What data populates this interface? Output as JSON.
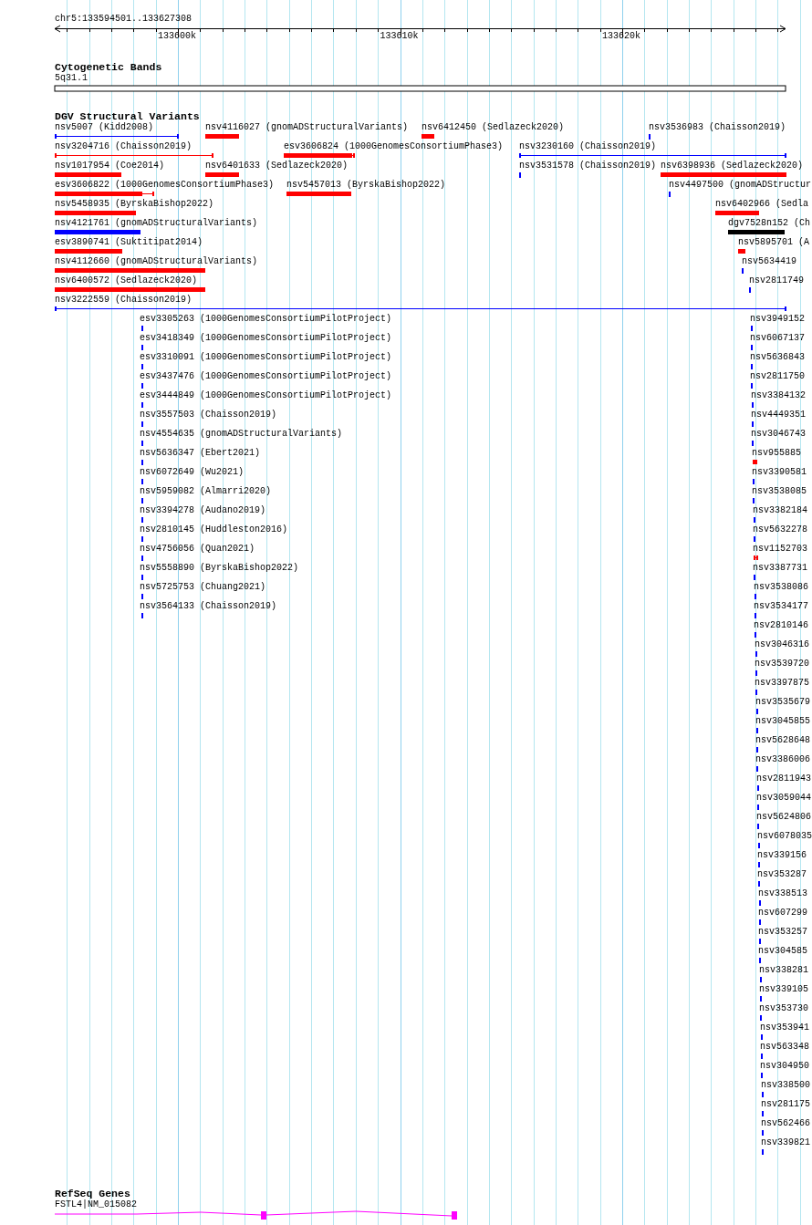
{
  "ruler": {
    "region": "chr5:133594501..133627308",
    "ticks": [
      "133600k",
      "133610k",
      "133620k"
    ]
  },
  "cytobands": {
    "title": "Cytogenetic Bands",
    "band": "5q31.1"
  },
  "variants": {
    "title": "DGV Structural Variants",
    "features": [
      {
        "label": "nsv5007 (Kidd2008)",
        "kind": "line",
        "color": "#0000ff"
      },
      {
        "label": "nsv4116027 (gnomADStructuralVariants)",
        "kind": "bar",
        "color": "#ff0000"
      },
      {
        "label": "nsv6412450 (Sedlazeck2020)",
        "kind": "bar",
        "color": "#ff0000"
      },
      {
        "label": "nsv3536983 (Chaisson2019)",
        "kind": "tick",
        "color": "#0000ff"
      },
      {
        "label": "nsv3204716 (Chaisson2019)",
        "kind": "line",
        "color": "#ff0000"
      },
      {
        "label": "esv3606824 (1000GenomesConsortiumPhase3)",
        "kind": "tail",
        "color": "#ff0000"
      },
      {
        "label": "nsv3230160 (Chaisson2019)",
        "kind": "line",
        "color": "#0000ff"
      },
      {
        "label": "nsv1017954 (Coe2014)",
        "kind": "bar",
        "color": "#ff0000"
      },
      {
        "label": "nsv6401633 (Sedlazeck2020)",
        "kind": "bar",
        "color": "#ff0000"
      },
      {
        "label": "nsv3531578 (Chaisson2019)",
        "kind": "tick",
        "color": "#0000ff"
      },
      {
        "label": "nsv6398936 (Sedlazeck2020)",
        "kind": "bar",
        "color": "#ff0000"
      },
      {
        "label": "esv3606822 (1000GenomesConsortiumPhase3)",
        "kind": "tail",
        "color": "#ff0000"
      },
      {
        "label": "nsv5457013 (ByrskaBishop2022)",
        "kind": "bar",
        "color": "#ff0000"
      },
      {
        "label": "nsv4497500 (gnomADStructur",
        "kind": "tick",
        "color": "#0000ff"
      },
      {
        "label": "nsv5458935 (ByrskaBishop2022)",
        "kind": "bar",
        "color": "#ff0000"
      },
      {
        "label": "nsv6402966 (Sedla",
        "kind": "bar",
        "color": "#ff0000"
      },
      {
        "label": "nsv4121761 (gnomADStructuralVariants)",
        "kind": "bar",
        "color": "#0000ff"
      },
      {
        "label": "dgv7528n152 (Ch",
        "kind": "bar",
        "color": "#000000"
      },
      {
        "label": "esv3890741 (Suktitipat2014)",
        "kind": "bar",
        "color": "#ff0000"
      },
      {
        "label": "nsv5895701 (A",
        "kind": "bar",
        "color": "#ff0000"
      },
      {
        "label": "nsv4112660 (gnomADStructuralVariants)",
        "kind": "bar",
        "color": "#ff0000"
      },
      {
        "label": "nsv5634419",
        "kind": "tick",
        "color": "#0000ff"
      },
      {
        "label": "nsv6400572 (Sedlazeck2020)",
        "kind": "bar",
        "color": "#ff0000"
      },
      {
        "label": "nsv2811749",
        "kind": "tick",
        "color": "#0000ff"
      },
      {
        "label": "nsv3222559 (Chaisson2019)",
        "kind": "line",
        "color": "#0000ff"
      }
    ],
    "left_stack": [
      {
        "label": "esv3305263 (1000GenomesConsortiumPilotProject)",
        "kind": "tick",
        "color": "#0000ff"
      },
      {
        "label": "esv3418349 (1000GenomesConsortiumPilotProject)",
        "kind": "tick",
        "color": "#0000ff"
      },
      {
        "label": "esv3310091 (1000GenomesConsortiumPilotProject)",
        "kind": "tick",
        "color": "#0000ff"
      },
      {
        "label": "esv3437476 (1000GenomesConsortiumPilotProject)",
        "kind": "tick",
        "color": "#0000ff"
      },
      {
        "label": "esv3444849 (1000GenomesConsortiumPilotProject)",
        "kind": "tick",
        "color": "#0000ff"
      },
      {
        "label": "nsv3557503 (Chaisson2019)",
        "kind": "tick",
        "color": "#0000ff"
      },
      {
        "label": "nsv4554635 (gnomADStructuralVariants)",
        "kind": "tick",
        "color": "#0000ff"
      },
      {
        "label": "nsv5636347 (Ebert2021)",
        "kind": "tick",
        "color": "#0000ff"
      },
      {
        "label": "nsv6072649 (Wu2021)",
        "kind": "tick",
        "color": "#0000ff"
      },
      {
        "label": "nsv5959082 (Almarri2020)",
        "kind": "tick",
        "color": "#0000ff"
      },
      {
        "label": "nsv3394278 (Audano2019)",
        "kind": "tick",
        "color": "#0000ff"
      },
      {
        "label": "nsv2810145 (Huddleston2016)",
        "kind": "tick",
        "color": "#0000ff"
      },
      {
        "label": "nsv4756056 (Quan2021)",
        "kind": "tick",
        "color": "#0000ff"
      },
      {
        "label": "nsv5558890 (ByrskaBishop2022)",
        "kind": "tick",
        "color": "#0000ff"
      },
      {
        "label": "nsv5725753 (Chuang2021)",
        "kind": "tick",
        "color": "#0000ff"
      },
      {
        "label": "nsv3564133 (Chaisson2019)",
        "kind": "tick",
        "color": "#0000ff"
      }
    ],
    "right_stack": [
      {
        "label": "nsv3949152",
        "kind": "tick",
        "color": "#0000ff"
      },
      {
        "label": "nsv6067137",
        "kind": "tick",
        "color": "#0000ff"
      },
      {
        "label": "nsv5636843",
        "kind": "tick",
        "color": "#0000ff"
      },
      {
        "label": "nsv2811750",
        "kind": "tick",
        "color": "#0000ff"
      },
      {
        "label": "nsv3384132",
        "kind": "tick",
        "color": "#0000ff"
      },
      {
        "label": "nsv4449351",
        "kind": "tick",
        "color": "#0000ff"
      },
      {
        "label": "nsv3046743",
        "kind": "tick",
        "color": "#0000ff"
      },
      {
        "label": "nsv955885",
        "kind": "bar",
        "color": "#ff0000"
      },
      {
        "label": "nsv3390581",
        "kind": "tick",
        "color": "#0000ff"
      },
      {
        "label": "nsv3538085",
        "kind": "tick",
        "color": "#0000ff"
      },
      {
        "label": "nsv3382184",
        "kind": "tick",
        "color": "#0000ff"
      },
      {
        "label": "nsv5632278",
        "kind": "tick",
        "color": "#0000ff"
      },
      {
        "label": "nsv1152703",
        "kind": "line",
        "color": "#ff0000"
      },
      {
        "label": "nsv3387731",
        "kind": "tick",
        "color": "#0000ff"
      },
      {
        "label": "nsv3538086",
        "kind": "tick",
        "color": "#0000ff"
      },
      {
        "label": "nsv3534177",
        "kind": "tick",
        "color": "#0000ff"
      },
      {
        "label": "nsv2810146",
        "kind": "tick",
        "color": "#0000ff"
      },
      {
        "label": "nsv3046316",
        "kind": "tick",
        "color": "#0000ff"
      },
      {
        "label": "nsv3539720",
        "kind": "tick",
        "color": "#0000ff"
      },
      {
        "label": "nsv3397875",
        "kind": "tick",
        "color": "#0000ff"
      },
      {
        "label": "nsv3535679",
        "kind": "tick",
        "color": "#0000ff"
      },
      {
        "label": "nsv3045855",
        "kind": "tick",
        "color": "#0000ff"
      },
      {
        "label": "nsv5628648",
        "kind": "tick",
        "color": "#0000ff"
      },
      {
        "label": "nsv3386006",
        "kind": "tick",
        "color": "#0000ff"
      },
      {
        "label": "nsv2811943",
        "kind": "tick",
        "color": "#0000ff"
      },
      {
        "label": "nsv3059044",
        "kind": "tick",
        "color": "#0000ff"
      },
      {
        "label": "nsv5624806",
        "kind": "tick",
        "color": "#0000ff"
      },
      {
        "label": "nsv6078035",
        "kind": "tick",
        "color": "#0000ff"
      },
      {
        "label": "nsv339156",
        "kind": "tick",
        "color": "#0000ff"
      },
      {
        "label": "nsv353287",
        "kind": "tick",
        "color": "#0000ff"
      },
      {
        "label": "nsv338513",
        "kind": "tick",
        "color": "#0000ff"
      },
      {
        "label": "nsv607299",
        "kind": "tick",
        "color": "#0000ff"
      },
      {
        "label": "nsv353257",
        "kind": "tick",
        "color": "#0000ff"
      },
      {
        "label": "nsv304585",
        "kind": "tick",
        "color": "#0000ff"
      },
      {
        "label": "nsv338281",
        "kind": "tick",
        "color": "#0000ff"
      },
      {
        "label": "nsv339105",
        "kind": "tick",
        "color": "#0000ff"
      },
      {
        "label": "nsv353730",
        "kind": "tick",
        "color": "#0000ff"
      },
      {
        "label": "nsv353941",
        "kind": "tick",
        "color": "#0000ff"
      },
      {
        "label": "nsv563348",
        "kind": "tick",
        "color": "#0000ff"
      },
      {
        "label": "nsv304950",
        "kind": "tick",
        "color": "#0000ff"
      },
      {
        "label": "nsv338500",
        "kind": "tick",
        "color": "#0000ff"
      },
      {
        "label": "nsv281175",
        "kind": "tick",
        "color": "#0000ff"
      },
      {
        "label": "nsv562466",
        "kind": "tick",
        "color": "#0000ff"
      },
      {
        "label": "nsv339821",
        "kind": "tick",
        "color": "#0000ff"
      }
    ]
  },
  "genes": {
    "title": "RefSeq Genes",
    "features": [
      {
        "label": "FSTL4|NM_015082"
      }
    ]
  }
}
